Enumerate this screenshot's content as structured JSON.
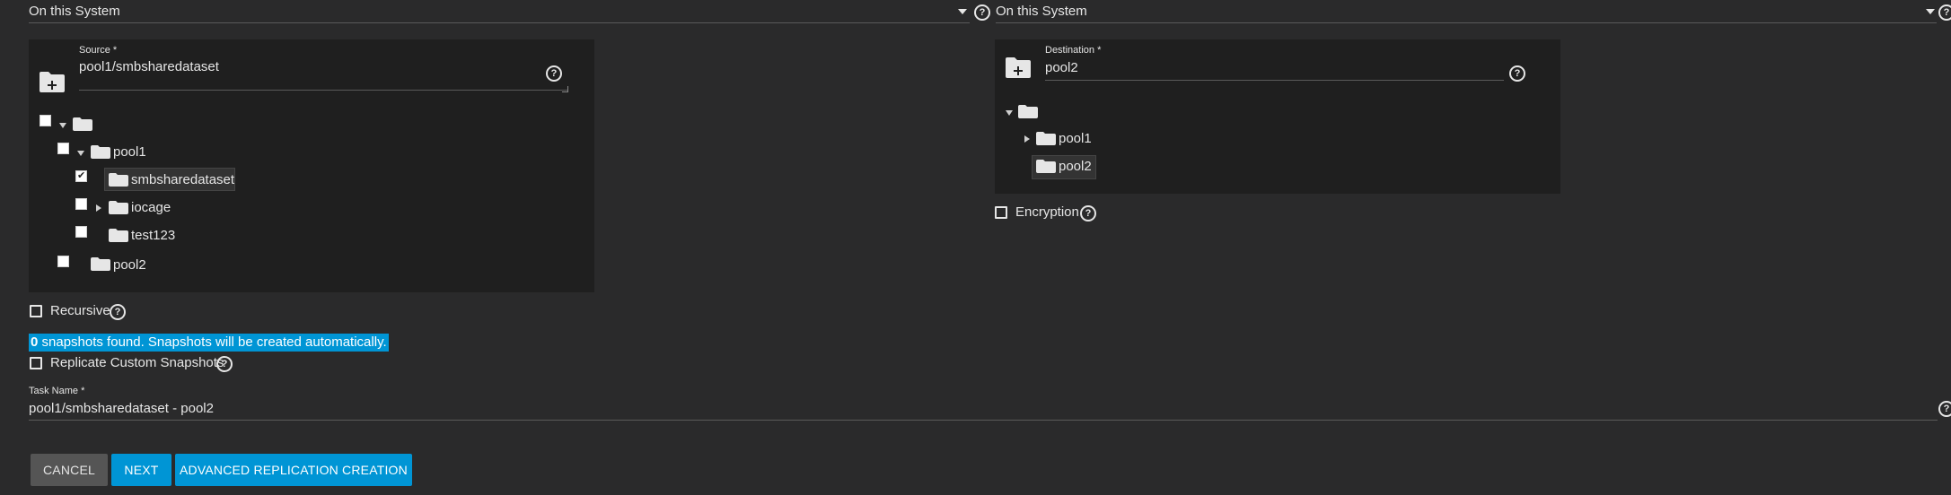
{
  "source_location": {
    "value": "On this System"
  },
  "destination_location": {
    "value": "On this System"
  },
  "source": {
    "label": "Source *",
    "value": "pool1/smbsharedataset",
    "tree": {
      "pool1": "pool1",
      "smbsharedataset": "smbsharedataset",
      "iocage": "iocage",
      "test123": "test123",
      "pool2": "pool2"
    },
    "checked": {
      "root": false,
      "pool1": false,
      "smbsharedataset": true,
      "iocage": false,
      "test123": false,
      "pool2": false
    }
  },
  "destination": {
    "label": "Destination *",
    "value": "pool2",
    "tree": {
      "pool1": "pool1",
      "pool2": "pool2"
    }
  },
  "options": {
    "recursive": "Recursive",
    "encryption": "Encryption",
    "replicate_custom": "Replicate Custom Snapshots"
  },
  "snapshots_info": {
    "count": "0",
    "text": " snapshots found. Snapshots will be created automatically."
  },
  "task_name": {
    "label": "Task Name *",
    "value": "pool1/smbsharedataset - pool2"
  },
  "buttons": {
    "cancel": "CANCEL",
    "next": "NEXT",
    "advanced": "ADVANCED REPLICATION CREATION"
  },
  "colors": {
    "accent": "#0095d5",
    "background": "#2a2a2b",
    "panel": "#1f1f1f"
  },
  "help_glyph": "?"
}
